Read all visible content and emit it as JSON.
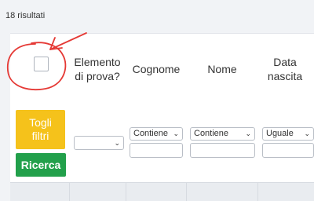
{
  "results": {
    "count_text": "18 risultati"
  },
  "table": {
    "headers": {
      "test_element": "Elemento\ndi prova?",
      "surname": "Cognome",
      "name": "Nome",
      "birth_date": "Data\nnascita"
    },
    "filters": {
      "test_element_value": "",
      "surname_operator": "Contiene",
      "name_operator": "Contiene",
      "birth_date_operator": "Uguale"
    }
  },
  "buttons": {
    "remove_filters": "Togli\nfiltri",
    "search": "Ricerca"
  },
  "colors": {
    "remove_filters_bg": "#f5c21b",
    "search_bg": "#22a04b",
    "annotation": "#e53935"
  },
  "icons": {
    "dropdown": "chevron-down-icon",
    "annotation": "hand-drawn-circle-arrow"
  }
}
